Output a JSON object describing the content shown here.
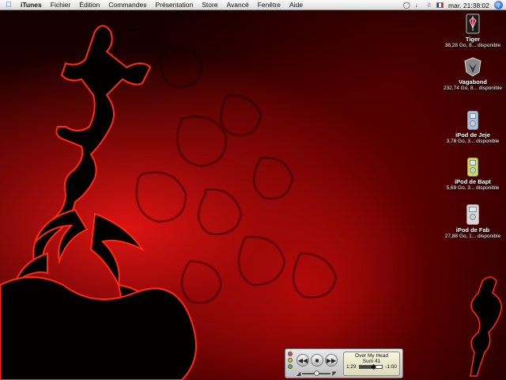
{
  "menubar": {
    "apple_icon": "apple-icon",
    "app_name": "iTunes",
    "items": [
      "Fichier",
      "Édition",
      "Commandes",
      "Présentation",
      "Store",
      "Avancé",
      "Fenêtre",
      "Aide"
    ],
    "clock": "mar. 21:38:02",
    "input_flag": "french-flag-icon",
    "spotlight_icon": "spotlight-icon"
  },
  "desktop_icons": [
    {
      "name": "Tiger",
      "info": "38,28 Go, 8... disponible",
      "icon": "hard-drive-icon"
    },
    {
      "name": "Vagabond",
      "info": "232,74 Go, 8... disponible",
      "icon": "hard-drive-icon"
    },
    {
      "name": "iPod de Jeje",
      "info": "3,78 Go, 3... disponible",
      "icon": "ipod-icon"
    },
    {
      "name": "iPod de Bapt",
      "info": "5,69 Go, 3... disponible",
      "icon": "ipod-icon"
    },
    {
      "name": "iPod de Fab",
      "info": "27,88 Go, 1... disponible",
      "icon": "ipod-icon"
    }
  ],
  "mini_player": {
    "song": "Over My Head",
    "artist": "Sum 41",
    "elapsed": "1:29",
    "remaining": "-1:00",
    "progress": 0.6,
    "volume": 0.5,
    "colors": {
      "close": "#e0463e",
      "minimize": "#e6b53a",
      "zoom": "#5fb04a",
      "ipod_jeje": "#9ec4ee",
      "ipod_bapt": "#c6e24a",
      "ipod_fab": "#d8d8d8"
    }
  }
}
